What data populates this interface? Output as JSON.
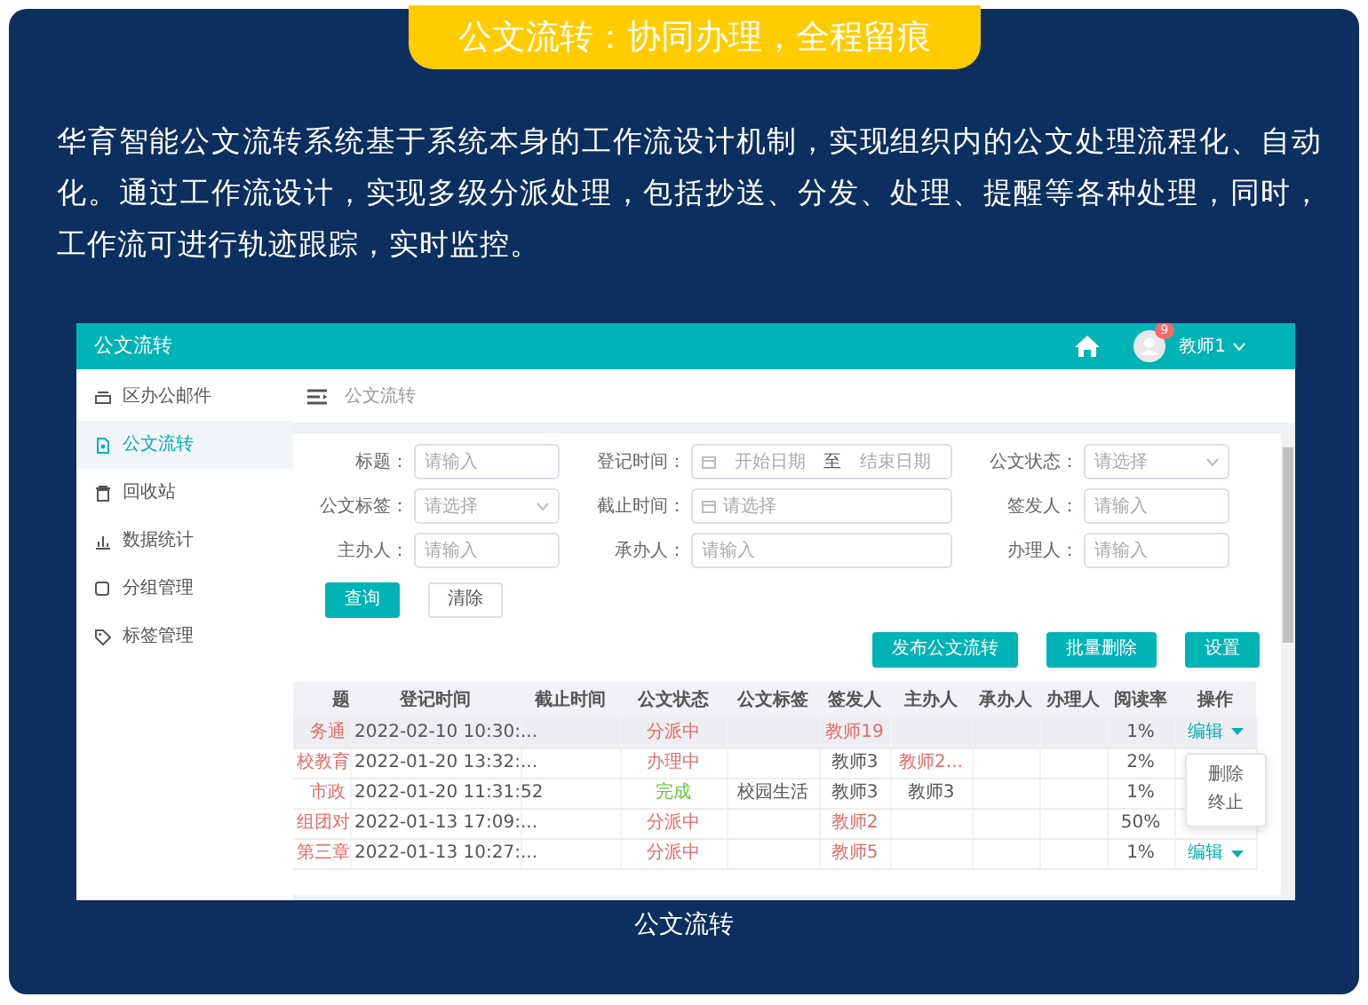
{
  "banner": {
    "title": "公文流转：协同办理，全程留痕"
  },
  "description": "华育智能公文流转系统基于系统本身的工作流设计机制，实现组织内的公文处理流程化、自动化。通过工作流设计，实现多级分派处理，包括抄送、分发、处理、提醒等各种处理，同时，工作流可进行轨迹跟踪，实时监控。",
  "screenshot": {
    "app_title": "公文流转",
    "user": {
      "name": "教师1",
      "badge": "9"
    },
    "sidebar": [
      {
        "label": "区办公邮件",
        "selected": false
      },
      {
        "label": "公文流转",
        "selected": true
      },
      {
        "label": "回收站",
        "selected": false
      },
      {
        "label": "数据统计",
        "selected": false
      },
      {
        "label": "分组管理",
        "selected": false
      },
      {
        "label": "标签管理",
        "selected": false
      }
    ],
    "breadcrumb": "公文流转",
    "filters": [
      {
        "label": "标题：",
        "kind": "text",
        "placeholder": "请输入"
      },
      {
        "label": "登记时间：",
        "kind": "daterange",
        "start": "开始日期",
        "separator": "至",
        "end": "结束日期"
      },
      {
        "label": "公文状态：",
        "kind": "select",
        "placeholder": "请选择"
      },
      {
        "label": "公文标签：",
        "kind": "select",
        "placeholder": "请选择"
      },
      {
        "label": "截止时间：",
        "kind": "date",
        "placeholder": "请选择"
      },
      {
        "label": "签发人：",
        "kind": "text",
        "placeholder": "请输入"
      },
      {
        "label": "主办人：",
        "kind": "text",
        "placeholder": "请输入"
      },
      {
        "label": "承办人：",
        "kind": "text",
        "placeholder": "请输入"
      },
      {
        "label": "办理人：",
        "kind": "text",
        "placeholder": "请输入"
      }
    ],
    "search_buttons": [
      {
        "label": "查询",
        "kind": "primary"
      },
      {
        "label": "清除",
        "kind": "plain"
      }
    ],
    "actions": [
      "发布公文流转",
      "批量删除",
      "设置"
    ],
    "table": {
      "columns": [
        "题",
        "登记时间",
        "截止时间",
        "公文状态",
        "公文标签",
        "签发人",
        "主办人",
        "承办人",
        "办理人",
        "阅读率",
        "操作"
      ],
      "rows": [
        {
          "selected": true,
          "cells": [
            {
              "text": "务通",
              "color": "#e46b6b"
            },
            {
              "text": "2022-02-10 10:30:..."
            },
            {
              "text": ""
            },
            {
              "text": "分派中",
              "color": "#e46b6b"
            },
            {
              "text": ""
            },
            {
              "text": "教师19",
              "color": "#e46b6b"
            },
            {
              "text": ""
            },
            {
              "text": ""
            },
            {
              "text": ""
            },
            {
              "text": "1%"
            },
            {
              "text": "编辑",
              "kind": "link"
            }
          ]
        },
        {
          "selected": false,
          "cells": [
            {
              "text": "校教育",
              "color": "#e46b6b"
            },
            {
              "text": "2022-01-20 13:32:..."
            },
            {
              "text": ""
            },
            {
              "text": "办理中",
              "color": "#e46b6b"
            },
            {
              "text": ""
            },
            {
              "text": "教师3"
            },
            {
              "text": "教师2...",
              "color": "#e46b6b"
            },
            {
              "text": ""
            },
            {
              "text": ""
            },
            {
              "text": "2%"
            },
            {
              "text": ""
            }
          ]
        },
        {
          "selected": false,
          "cells": [
            {
              "text": "市政",
              "color": "#e46b6b"
            },
            {
              "text": "2022-01-20 11:31:52"
            },
            {
              "text": ""
            },
            {
              "text": "完成",
              "color": "#67c23a"
            },
            {
              "text": "校园生活"
            },
            {
              "text": "教师3"
            },
            {
              "text": "教师3"
            },
            {
              "text": ""
            },
            {
              "text": ""
            },
            {
              "text": "1%"
            },
            {
              "text": ""
            }
          ]
        },
        {
          "selected": false,
          "cells": [
            {
              "text": "组团对",
              "color": "#e46b6b"
            },
            {
              "text": "2022-01-13 17:09:..."
            },
            {
              "text": ""
            },
            {
              "text": "分派中",
              "color": "#e46b6b"
            },
            {
              "text": ""
            },
            {
              "text": "教师2",
              "color": "#e46b6b"
            },
            {
              "text": ""
            },
            {
              "text": ""
            },
            {
              "text": ""
            },
            {
              "text": "50%"
            },
            {
              "text": ""
            }
          ]
        },
        {
          "selected": false,
          "cells": [
            {
              "text": "第三章",
              "color": "#e46b6b"
            },
            {
              "text": "2022-01-13 10:27:..."
            },
            {
              "text": ""
            },
            {
              "text": "分派中",
              "color": "#e46b6b"
            },
            {
              "text": ""
            },
            {
              "text": "教师5",
              "color": "#e46b6b"
            },
            {
              "text": ""
            },
            {
              "text": ""
            },
            {
              "text": ""
            },
            {
              "text": "1%"
            },
            {
              "text": "编辑",
              "kind": "link"
            }
          ]
        }
      ]
    },
    "dropdown": [
      "删除",
      "终止"
    ]
  },
  "caption": "公文流转"
}
